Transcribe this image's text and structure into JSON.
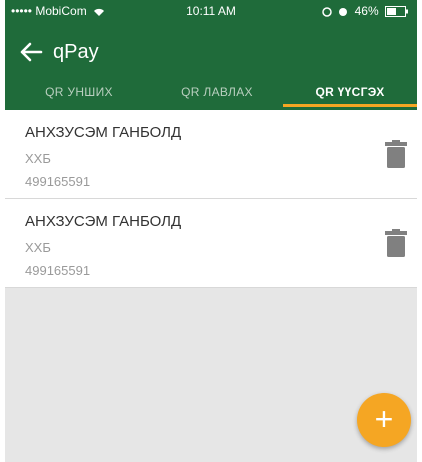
{
  "status_bar": {
    "carrier": "••••• MobiCom",
    "time": "10:11 AM",
    "battery": "46%"
  },
  "header": {
    "title": "qPay",
    "back_icon": "arrow-left-icon"
  },
  "tabs": [
    {
      "label": "QR УНШИХ",
      "active": false
    },
    {
      "label": "QR ЛАВЛАХ",
      "active": false
    },
    {
      "label": "QR ҮҮСГЭХ",
      "active": true
    }
  ],
  "accounts": [
    {
      "name": "АНХЗУСЭМ ГАНБОЛД",
      "bank": "ХХБ",
      "account_number": "499165591",
      "action_icon": "trash-icon"
    },
    {
      "name": "АНХЗУСЭМ ГАНБОЛД",
      "bank": "ХХБ",
      "account_number": "499165591",
      "action_icon": "trash-icon"
    }
  ],
  "fab": {
    "label": "+",
    "icon": "plus-icon"
  },
  "colors": {
    "header": "#1f6b3a",
    "accent": "#f5a623",
    "background": "#e6e6e6"
  }
}
